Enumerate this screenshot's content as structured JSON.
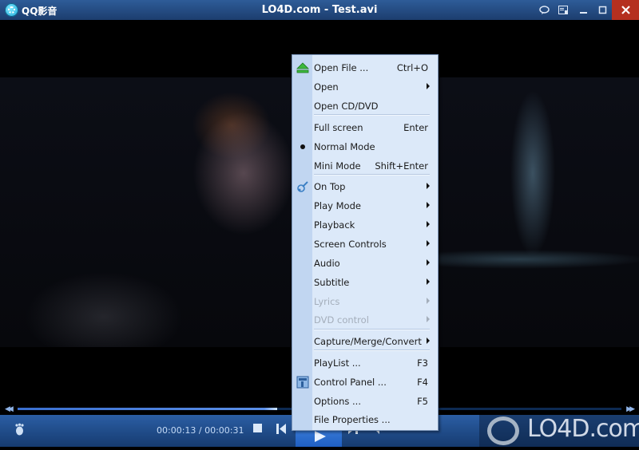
{
  "titlebar": {
    "app_name": "QQ影音",
    "window_title": "LO4D.com - Test.avi",
    "buttons": [
      {
        "icon": "chat-bubble-icon",
        "glyph": "💬"
      },
      {
        "icon": "playlist-panel-icon",
        "glyph": "▣"
      },
      {
        "icon": "minimize-icon",
        "glyph": "–"
      },
      {
        "icon": "maximize-icon",
        "glyph": "☐"
      },
      {
        "icon": "close-icon",
        "glyph": "✕"
      }
    ]
  },
  "player": {
    "current_time": "00:00:13",
    "total_time": "00:00:31",
    "time_display": "00:00:13 / 00:00:31",
    "progress_percent": 43,
    "seek_back_glyph": "◀◀",
    "seek_forward_glyph": "▶▶",
    "controls": {
      "footprint_glyph": "👣",
      "stop_glyph": "■",
      "prev_glyph": "⏮",
      "play_glyph": "▶",
      "next_glyph": "⏭",
      "volume_glyph": "🔈"
    }
  },
  "watermark": {
    "text": "LO4D.com"
  },
  "context_menu": {
    "items": [
      {
        "label": "Open File ...",
        "shortcut": "Ctrl+O",
        "icon": "eject-icon",
        "submenu": false,
        "disabled": false
      },
      {
        "label": "Open",
        "shortcut": "",
        "submenu": true,
        "disabled": false
      },
      {
        "label": "Open CD/DVD",
        "shortcut": "",
        "submenu": false,
        "disabled": false
      },
      {
        "label": "Full screen",
        "shortcut": "Enter",
        "submenu": false,
        "disabled": false
      },
      {
        "label": "Normal Mode",
        "shortcut": "",
        "submenu": false,
        "disabled": false,
        "checked": true
      },
      {
        "label": "Mini Mode",
        "shortcut": "Shift+Enter",
        "submenu": false,
        "disabled": false
      },
      {
        "label": "On Top",
        "shortcut": "",
        "icon": "pin-icon",
        "submenu": true,
        "disabled": false
      },
      {
        "label": "Play Mode",
        "shortcut": "",
        "submenu": true,
        "disabled": false
      },
      {
        "label": "Playback",
        "shortcut": "",
        "submenu": true,
        "disabled": false
      },
      {
        "label": "Screen Controls",
        "shortcut": "",
        "submenu": true,
        "disabled": false
      },
      {
        "label": "Audio",
        "shortcut": "",
        "submenu": true,
        "disabled": false
      },
      {
        "label": "Subtitle",
        "shortcut": "",
        "submenu": true,
        "disabled": false
      },
      {
        "label": "Lyrics",
        "shortcut": "",
        "submenu": true,
        "disabled": true
      },
      {
        "label": "DVD control",
        "shortcut": "",
        "submenu": true,
        "disabled": true
      },
      {
        "label": "Capture/Merge/Convert",
        "shortcut": "",
        "submenu": true,
        "disabled": false
      },
      {
        "label": "PlayList ...",
        "shortcut": "F3",
        "submenu": false,
        "disabled": false
      },
      {
        "label": "Control Panel ...",
        "shortcut": "F4",
        "icon": "control-panel-icon",
        "submenu": false,
        "disabled": false
      },
      {
        "label": "Options ...",
        "shortcut": "F5",
        "submenu": false,
        "disabled": false
      },
      {
        "label": "File Properties ...",
        "shortcut": "",
        "submenu": false,
        "disabled": false
      }
    ]
  }
}
